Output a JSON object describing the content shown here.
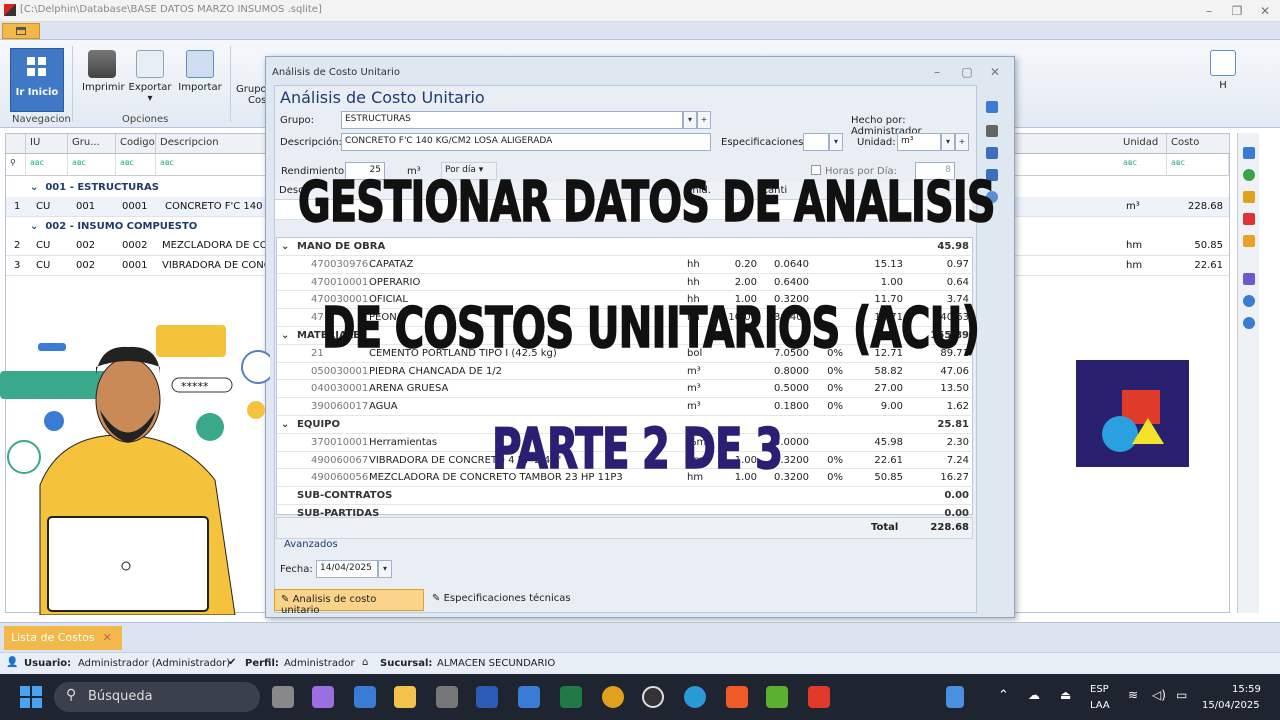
{
  "window": {
    "title": "[C:\\Delphin\\Database\\BASE DATOS MARZO INSUMOS .sqlite]"
  },
  "ribbon": {
    "home_btn": "Ir Inicio",
    "groups": {
      "nav": "Navegacion",
      "opt": "Opciones"
    },
    "buttons": {
      "print": "Imprimir",
      "export": "Exportar",
      "import": "Importar",
      "group": "Grupo",
      "cost": "Cos",
      "h": "H"
    }
  },
  "grid": {
    "headers": {
      "iu": "IU",
      "gru": "Gru...",
      "codigo": "Codigo",
      "descripcion": "Descripcion",
      "unidad": "Unidad",
      "costo": "Costo"
    },
    "filter": "aʙc",
    "groups": [
      {
        "title": "001 - ESTRUCTURAS",
        "rows": [
          {
            "n": "1",
            "cu": "CU",
            "g": "001",
            "c": "0001",
            "d": "CONCRETO F'C 140 KG",
            "u": "m³",
            "cost": "228.68"
          }
        ]
      },
      {
        "title": "002 - INSUMO COMPUESTO",
        "rows": [
          {
            "n": "2",
            "cu": "CU",
            "g": "002",
            "c": "0002",
            "d": "MEZCLADORA DE CONC",
            "u": "hm",
            "cost": "50.85"
          },
          {
            "n": "3",
            "cu": "CU",
            "g": "002",
            "c": "0001",
            "d": "VIBRADORA DE CONCR",
            "u": "hm",
            "cost": "22.61"
          }
        ]
      }
    ]
  },
  "dialog": {
    "window_title": "Análisis de Costo Unitario",
    "heading": "Análisis de Costo Unitario",
    "grupo_label": "Grupo:",
    "grupo_value": "ESTRUCTURAS",
    "hecho_por": "Hecho por:  Administrador",
    "desc_label": "Descripción:",
    "desc_value": "CONCRETO F'C 140 KG/CM2 LOSA ALIGERADA",
    "espec_label": "Especificaciones:",
    "unidad_label": "Unidad:",
    "unidad_value": "m³",
    "rend_label": "Rendimiento",
    "rend_value": "25",
    "rend_unit": "m³",
    "por_dia": "Por día",
    "horas_label": "Horas por Día:",
    "horas_value": "8",
    "col_desc": "Descri",
    "col_unid": "Unid.",
    "col_cant": "Canti",
    "sections": [
      {
        "name": "MANO DE OBRA",
        "total": "45.98",
        "items": [
          {
            "code": "470030976",
            "desc": "CAPATAZ",
            "u": "hh",
            "cuad": "0.20",
            "cant": "0.0640",
            "pct": "",
            "pu": "15.13",
            "parc": "0.97"
          },
          {
            "code": "470010001",
            "desc": "OPERARIO",
            "u": "hh",
            "cuad": "2.00",
            "cant": "0.6400",
            "pct": "",
            "pu": "1.00",
            "parc": "0.64"
          },
          {
            "code": "470030001",
            "desc": "OFICIAL",
            "u": "hh",
            "cuad": "1.00",
            "cant": "0.3200",
            "pct": "",
            "pu": "11.70",
            "parc": "3.74"
          },
          {
            "code": "47",
            "desc": "PEON",
            "u": "hh",
            "cuad": "10.00",
            "cant": "3.2400",
            "pct": "",
            "pu": "12.71",
            "parc": "40.63"
          }
        ]
      },
      {
        "name": "MATERIALES",
        "total": "155.89",
        "items": [
          {
            "code": "21",
            "desc": "CEMENTO PORTLAND TIPO I (42.5 kg)",
            "u": "bol",
            "cuad": "",
            "cant": "7.0500",
            "pct": "0%",
            "pu": "12.71",
            "parc": "89.71"
          },
          {
            "code": "050030001",
            "desc": "PIEDRA CHANCADA DE 1/2",
            "u": "m³",
            "cuad": "",
            "cant": "0.8000",
            "pct": "0%",
            "pu": "58.82",
            "parc": "47.06"
          },
          {
            "code": "040030001",
            "desc": "ARENA GRUESA",
            "u": "m³",
            "cuad": "",
            "cant": "0.5000",
            "pct": "0%",
            "pu": "27.00",
            "parc": "13.50"
          },
          {
            "code": "390060017",
            "desc": "AGUA",
            "u": "m³",
            "cuad": "",
            "cant": "0.1800",
            "pct": "0%",
            "pu": "9.00",
            "parc": "1.62"
          }
        ]
      },
      {
        "name": "EQUIPO",
        "total": "25.81",
        "items": [
          {
            "code": "370010001",
            "desc": "Herramientas",
            "u": "%mo",
            "cuad": "",
            "cant": "5.0000",
            "pct": "",
            "pu": "45.98",
            "parc": "2.30"
          },
          {
            "code": "490060067",
            "desc": "VIBRADORA DE CONCRETO 4 HP 2.40\"",
            "u": "hm",
            "cuad": "1.00",
            "cant": "0.3200",
            "pct": "0%",
            "pu": "22.61",
            "parc": "7.24"
          },
          {
            "code": "490060056",
            "desc": "MEZCLADORA DE CONCRETO TAMBOR 23 HP 11P3",
            "u": "hm",
            "cuad": "1.00",
            "cant": "0.3200",
            "pct": "0%",
            "pu": "50.85",
            "parc": "16.27"
          }
        ]
      }
    ],
    "subcontratos": "SUB-CONTRATOS",
    "subcontratos_val": "0.00",
    "subpartidas": "SUB-PARTIDAS",
    "subpartidas_val": "0.00",
    "total_label": "Total",
    "total_value": "228.68",
    "avanzados": "Avanzados",
    "fecha_label": "Fecha:",
    "fecha_value": "14/04/2025",
    "tab1": "Analisis de costo unitario",
    "tab2": "Especificaciones técnicas"
  },
  "overlay": {
    "line1": "GESTIONAR DATOS DE ANALISIS",
    "line2": "DE COSTOS UNIITARIOS (ACU)",
    "line3": "PARTE 2 DE 3",
    "bubble": "*****"
  },
  "bottom": {
    "list_tab": "Lista de Costos",
    "status": {
      "user_label": "Usuario:",
      "user": "Administrador (Administrador)",
      "perfil_label": "Perfil:",
      "perfil": "Administrador",
      "suc_label": "Sucursal:",
      "suc": "ALMACEN SECUNDARIO"
    }
  },
  "taskbar": {
    "search": "Búsqueda",
    "lang1": "ESP",
    "lang2": "LAA",
    "time": "15:59",
    "date": "15/04/2025"
  },
  "colors": {
    "accent": "#f2b84a",
    "ribbon": "#dbe4f0",
    "overlay_part": "#2a1f73"
  }
}
